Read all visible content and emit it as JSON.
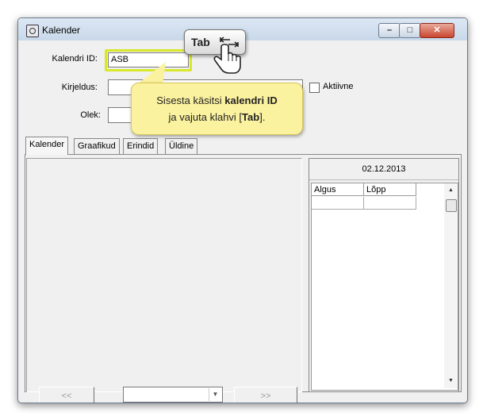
{
  "window": {
    "title": "Kalender"
  },
  "form": {
    "id_label": "Kalendri ID:",
    "id_value": "ASB",
    "desc_label": "Kirjeldus:",
    "desc_value": "",
    "state_label": "Olek:",
    "state_value": "",
    "active_label": "Aktiivne"
  },
  "tabs": [
    {
      "label": "Kalender"
    },
    {
      "label": "Graafikud"
    },
    {
      "label": "Erindid"
    },
    {
      "label": "Üldine"
    }
  ],
  "calendar": {
    "date": "02.12.2013",
    "columns": [
      "Algus",
      "Lõpp"
    ],
    "prev_label": "<<",
    "next_label": ">>",
    "combo_value": ""
  },
  "callout": {
    "line1_pre": "Sisesta käsitsi ",
    "line1_bold": "kalendri ID",
    "line2_pre": "ja vajuta klahvi [",
    "line2_bold": "Tab",
    "line2_post": "]."
  },
  "key_hint": {
    "label": "Tab"
  }
}
